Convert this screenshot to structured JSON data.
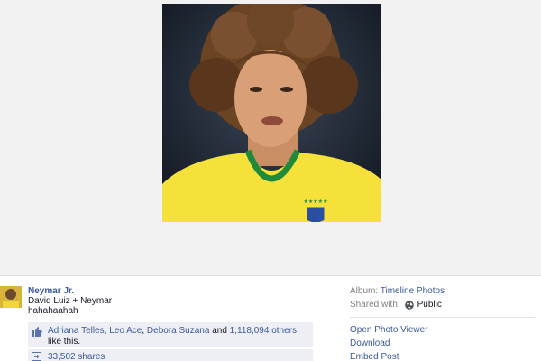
{
  "post": {
    "author": "Neymar Jr.",
    "caption_line1": "David Luiz + Neymar",
    "caption_line2": "hahahaahah"
  },
  "likes": {
    "names": [
      "Adriana Telles",
      "Leo Ace",
      "Debora Suzana"
    ],
    "separator1": ", ",
    "separator2": ", ",
    "separator3": " and ",
    "others": "1,118,094 others",
    "suffix": " like this."
  },
  "shares": {
    "label": "33,502 shares"
  },
  "sidebar": {
    "album_label": "Album:",
    "album_name": "Timeline Photos",
    "shared_label": "Shared with:",
    "shared_value": "Public",
    "actions": [
      "Open Photo Viewer",
      "Download",
      "Embed Post"
    ]
  },
  "colors": {
    "link": "#3b5998",
    "stage_bg": "#f2f2f2",
    "likes_bg": "#edeff4",
    "jersey": "#f5e13a",
    "collar": "#1f8a3a"
  },
  "icons": {
    "like": "thumbs-up-icon",
    "share": "share-icon",
    "audience": "globe-icon"
  }
}
